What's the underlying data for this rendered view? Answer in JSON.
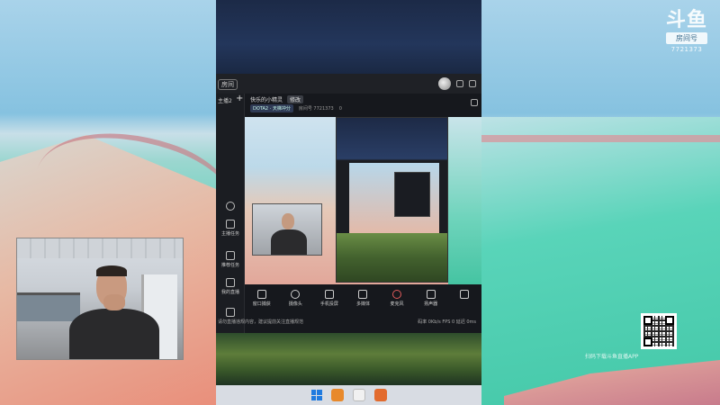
{
  "watermark": {
    "logo": "斗鱼",
    "tag": "房间号",
    "room": "7721373"
  },
  "qr_caption": "扫码下载斗鱼直播APP",
  "app": {
    "top_home": "房间",
    "sidebar": {
      "title": "主播2",
      "plus": "+",
      "items": [
        {
          "label": ""
        },
        {
          "label": "主播任务"
        },
        {
          "label": "推荐任务"
        },
        {
          "label": "我的直播"
        },
        {
          "label": ""
        }
      ]
    },
    "room": {
      "name": "快乐的小精灵",
      "badge": "修改",
      "game": "DOTA2 · 天梯冲分",
      "id_label": "房间号 7721373",
      "fans": "0"
    },
    "toolbar": [
      {
        "label": "窗口捕获"
      },
      {
        "label": "摄像头"
      },
      {
        "label": "手机投屏"
      },
      {
        "label": "多媒体"
      },
      {
        "label": "麦克风"
      },
      {
        "label": "扬声器"
      },
      {
        "label": ""
      }
    ],
    "notice": "请勿直播违规内容，建议提前关注直播规范",
    "notice_right": "码率 0Kb/s   FPS 0   延迟 0ms"
  },
  "colors": {
    "accent": "#1f7adf",
    "mic": "#e05a5a"
  }
}
